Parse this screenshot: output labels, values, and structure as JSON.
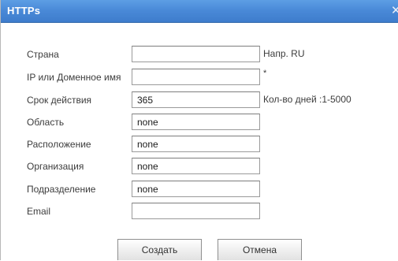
{
  "window": {
    "title": "HTTPs",
    "close_glyph": "✕"
  },
  "form": {
    "fields": [
      {
        "label": "Страна",
        "value": "",
        "hint": "Напр. RU"
      },
      {
        "label": "IP или Доменное имя",
        "value": "",
        "hint": "*"
      },
      {
        "label": "Срок действия",
        "value": "365",
        "hint": "Кол-во дней :1-5000"
      },
      {
        "label": "Область",
        "value": "none",
        "hint": ""
      },
      {
        "label": "Расположение",
        "value": "none",
        "hint": ""
      },
      {
        "label": "Организация",
        "value": "none",
        "hint": ""
      },
      {
        "label": "Подразделение",
        "value": "none",
        "hint": ""
      },
      {
        "label": "Email",
        "value": "",
        "hint": ""
      }
    ]
  },
  "actions": {
    "create_label": "Создать",
    "cancel_label": "Отмена"
  }
}
